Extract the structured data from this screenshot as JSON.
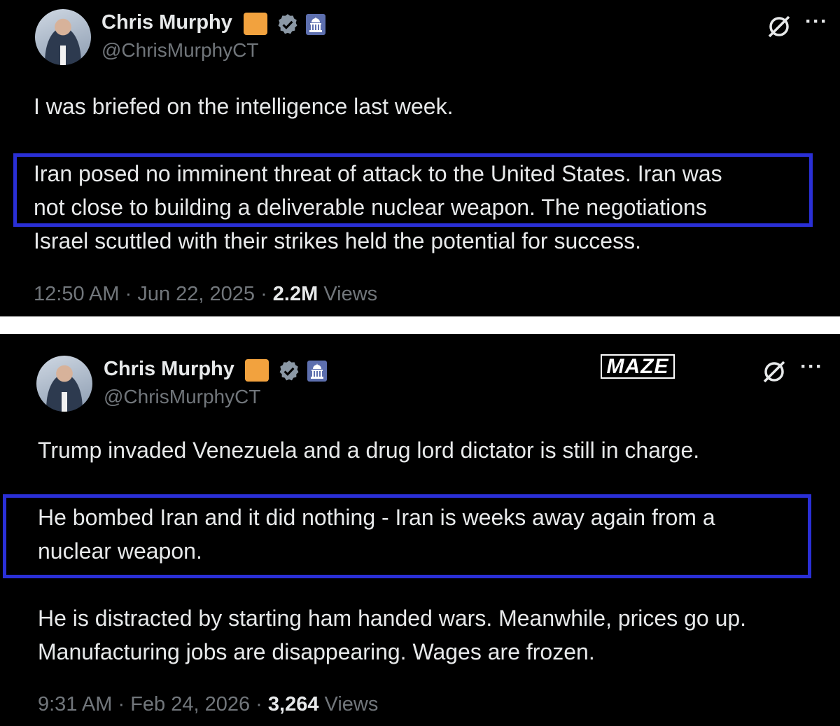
{
  "tweets": [
    {
      "author_name": "Chris Murphy",
      "handle": "@ChrisMurphyCT",
      "paragraph1": "I was briefed on the intelligence last week.",
      "highlight_lines": [
        "Iran posed no imminent threat of attack to the United States. Iran was",
        "not close to building a deliverable nuclear weapon. The negotiations"
      ],
      "after_lines": [
        "Israel scuttled with their strikes held the potential for success."
      ],
      "time": "12:50 AM",
      "date": "Jun 22, 2025",
      "views_count": "2.2M",
      "views_label": "Views"
    },
    {
      "author_name": "Chris Murphy",
      "handle": "@ChrisMurphyCT",
      "paragraph1": "Trump invaded Venezuela and a drug lord dictator is still in charge.",
      "highlight_lines": [
        "He bombed Iran and it did nothing - Iran is weeks away again from a",
        "nuclear weapon."
      ],
      "after_lines": [
        "He is distracted by starting ham handed wars. Meanwhile, prices go up.",
        "Manufacturing jobs are disappearing. Wages are frozen."
      ],
      "time": "9:31 AM",
      "date": "Feb 24, 2026",
      "views_count": "3,264",
      "views_label": "Views"
    }
  ],
  "watermark": "MAZE",
  "separator": " · ",
  "colors": {
    "background": "#000000",
    "text": "#e7e9ea",
    "muted": "#71767b",
    "highlight_border": "#2a2fd6",
    "badge_orange": "#f2a23e",
    "verified": "#8b98a5",
    "capitol_badge": "#5d6fae"
  },
  "icons": [
    "verified-badge-icon",
    "capitol-icon",
    "grok-icon",
    "more-icon"
  ]
}
